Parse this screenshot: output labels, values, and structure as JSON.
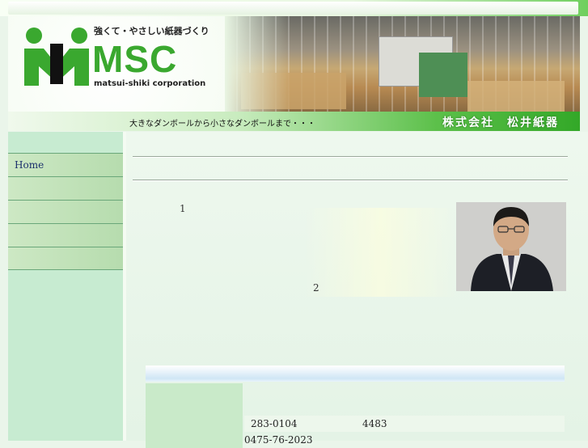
{
  "header": {
    "tagline": "強くて・やさしい紙器づくり",
    "logo_text": "MSC",
    "corporation": "matsui-shiki corporation"
  },
  "banner": {
    "slogan": "大きなダンボールから小さなダンボールまで・・・",
    "company": "株式会社　松井紙器"
  },
  "sidebar": {
    "items": [
      {
        "label": "Home"
      },
      {
        "label": ""
      },
      {
        "label": ""
      },
      {
        "label": ""
      },
      {
        "label": ""
      }
    ]
  },
  "main": {
    "marker_1": "1",
    "marker_2": "2",
    "info": {
      "postal": "283-0104",
      "address_number": "4483",
      "phone": "0475-76-2023"
    }
  },
  "colors": {
    "brand_green": "#3aa82f",
    "sidebar_bg": "#c7ebd1",
    "nav_text": "#1a2f6b"
  }
}
